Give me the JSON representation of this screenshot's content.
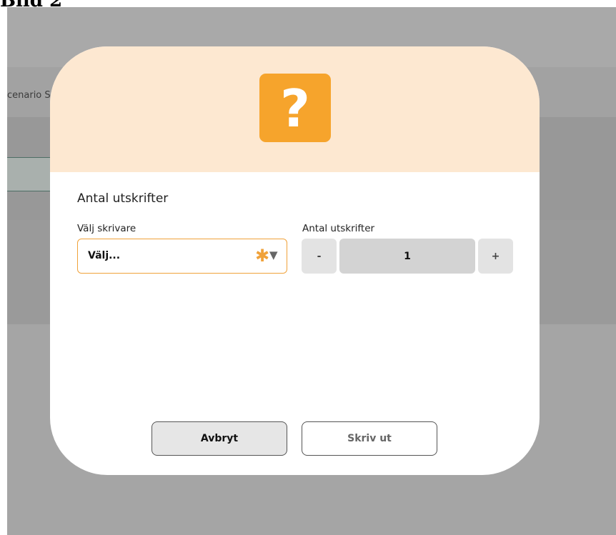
{
  "caption": "Bild 2",
  "background": {
    "breadcrumb_text": "cenario Sko"
  },
  "dialog": {
    "header_icon": "question-mark-icon",
    "header_icon_glyph": "?",
    "accent_color": "#f6a42c",
    "header_color": "#fde8d1",
    "title": "Antal utskrifter",
    "printer": {
      "label": "Välj skrivare",
      "value": "Välj...",
      "required_marker": "✱",
      "chevron": "▼"
    },
    "copies": {
      "label": "Antal utskrifter",
      "decrement": "-",
      "value": "1",
      "increment": "+"
    },
    "buttons": {
      "cancel": "Avbryt",
      "print": "Skriv ut"
    }
  }
}
